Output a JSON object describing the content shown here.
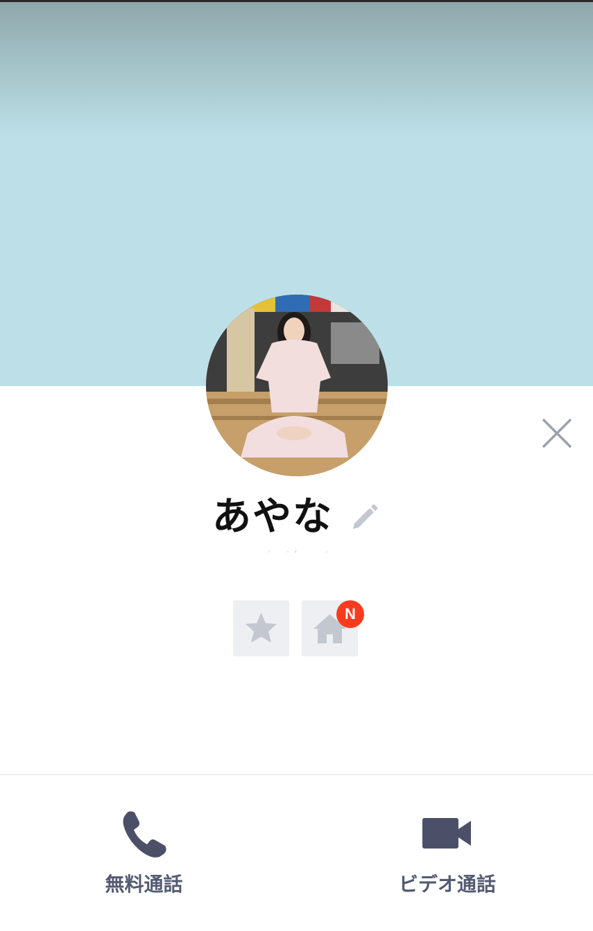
{
  "profile": {
    "name": "あやな"
  },
  "quick_actions": {
    "favorite_icon": "star-icon",
    "home_icon": "home-icon",
    "home_badge": "N"
  },
  "calls": {
    "voice_label": "無料通話",
    "video_label": "ビデオ通話"
  },
  "colors": {
    "cover": "#bde0e8",
    "icon_gray": "#c3c7cf",
    "badge": "#fa3b1d",
    "call_icon": "#4b5068"
  }
}
